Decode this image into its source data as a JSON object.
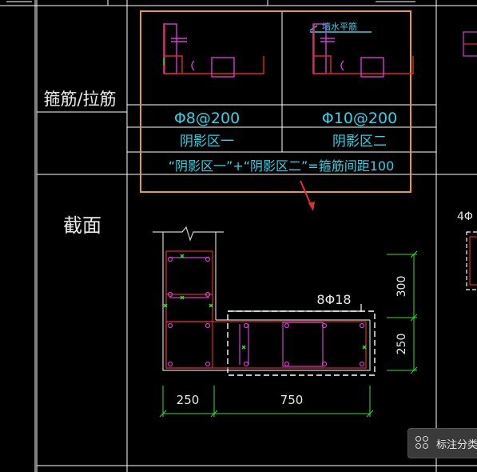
{
  "table": {
    "row_labels": {
      "stirrup": "箍筋/拉筋",
      "section": "截面"
    }
  },
  "detail_box": {
    "wall_label": "墙水平筋",
    "left_spec": "Φ8@200",
    "right_spec": "Φ10@200",
    "left_zone": "阴影区一",
    "right_zone": "阴影区二",
    "formula": "“阴影区一”+“阴影区二”=箍筋间距100"
  },
  "section_drawing": {
    "rebar_label": "8Φ18",
    "dims": {
      "right_top": "300",
      "right_bottom": "250",
      "bottom_left": "250",
      "bottom_right": "750"
    },
    "right_edge_label": "4Φ"
  },
  "float_button": {
    "label": "标注分类",
    "icon": "grid-circles-icon"
  },
  "colors": {
    "background": "#000000",
    "grid_line": "#ffffff",
    "highlight_box": "#e6a020",
    "concrete_outline": "#d0d0d0",
    "rebar_red": "#e02828",
    "stirrup_magenta": "#d040d0",
    "text_cyan": "#32d2e6",
    "dim_green": "#30e030",
    "arrow_red": "#e03030"
  }
}
